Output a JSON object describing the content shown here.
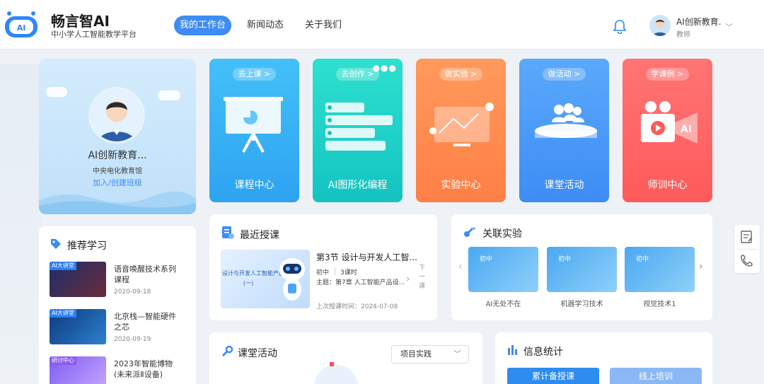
{
  "brand": {
    "title": "畅言智AI",
    "subtitle": "中小学人工智能教学平台"
  },
  "nav": [
    {
      "label": "我的工作台",
      "active": true
    },
    {
      "label": "新闻动态"
    },
    {
      "label": "关于我们"
    }
  ],
  "user": {
    "name": "AI创新教育...",
    "role": "教师"
  },
  "profile": {
    "name": "AI创新教育...",
    "org": "中央电化教育馆",
    "link": "加入/创建班级"
  },
  "cards": [
    {
      "pill": "去上课 >",
      "title": "课程中心",
      "color": "#3ab6f6"
    },
    {
      "pill": "去创作 >",
      "title": "AI图形化编程",
      "color": "#1fd2c9"
    },
    {
      "pill": "做实验 >",
      "title": "实验中心",
      "color": "#ff8d54"
    },
    {
      "pill": "做活动 >",
      "title": "课堂活动",
      "color": "#4d9ef9"
    },
    {
      "pill": "学课例 >",
      "title": "师训中心",
      "color": "#ff6b6b"
    }
  ],
  "recommend": {
    "title": "推荐学习",
    "items": [
      {
        "tag": "AI大讲堂",
        "title": "语音唤醒技术系列课程",
        "date": "2020-09-18"
      },
      {
        "tag": "AI大讲堂",
        "title": "北京栈—智能硬件之芯",
        "date": "2020-09-19"
      },
      {
        "tag": "研讨中心",
        "title": "2023年智能博物(未来派Ⅱ设备)",
        "date": ""
      }
    ]
  },
  "recent": {
    "title": "最近授课",
    "lesson": "第3节 设计与开发人工智...",
    "grade": "初中",
    "hours": "3课时",
    "topic": "主题：第7章 人工智能产品设...",
    "last_time": "上次授课时间：2024-07-08",
    "thumb_text": "设计与开发人工智能产品",
    "thumb_sub": "(一)",
    "next": "下一课"
  },
  "labs": {
    "title": "关联实验",
    "items": [
      {
        "badge": "初中",
        "label": "AI无处不在"
      },
      {
        "badge": "初中",
        "label": "机器学习技术"
      },
      {
        "badge": "初中",
        "label": "视觉技术1"
      }
    ]
  },
  "activity": {
    "title": "课堂活动",
    "select_value": "项目实践"
  },
  "stats": {
    "title": "信息统计",
    "buttons": [
      "累计备授课",
      "线上培训"
    ]
  }
}
